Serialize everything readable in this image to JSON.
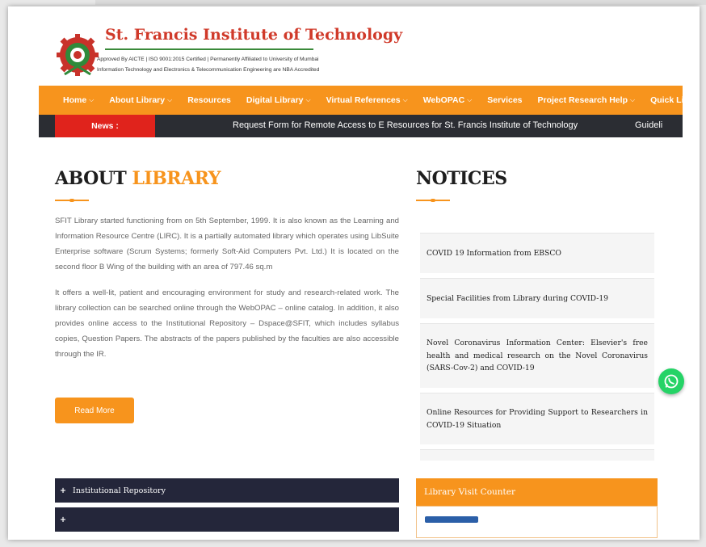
{
  "header": {
    "institute_name": "St. Francis Institute of Technology",
    "subtitle_line1": "Approved By AICTE | ISO 9001:2015 Certified | Permanently Affiliated to University of Mumbai",
    "subtitle_line2": "Information Technology and Electronics & Telecommunication Engineering are NBA Accredited"
  },
  "nav": {
    "items": [
      {
        "label": "Home",
        "dropdown": true
      },
      {
        "label": "About Library",
        "dropdown": true
      },
      {
        "label": "Resources",
        "dropdown": false
      },
      {
        "label": "Digital Library",
        "dropdown": true
      },
      {
        "label": "Virtual References",
        "dropdown": true
      },
      {
        "label": "WebOPAC",
        "dropdown": true
      },
      {
        "label": "Services",
        "dropdown": false
      },
      {
        "label": "Project Research Help",
        "dropdown": true
      },
      {
        "label": "Quick Links",
        "dropdown": true
      }
    ]
  },
  "news": {
    "label": "News :",
    "ticker": "Request Form for Remote Access to E Resources for St. Francis Institute of Technology",
    "ticker_next": "Guideli"
  },
  "about": {
    "title_main": "ABOUT ",
    "title_accent": "LIBRARY",
    "para1": "SFIT Library started functioning from on 5th September, 1999. It is also known as the Learning and Information Resource Centre (LIRC). It is a partially automated library which operates using LibSuite Enterprise software (Scrum Systems; formerly Soft-Aid Computers Pvt. Ltd.) It is located on the second floor B Wing of the building with an area of 797.46 sq.m",
    "para2": "It offers a well-lit, patient and encouraging environment for study and research-related work. The library collection can be searched online through the WebOPAC – online catalog. In addition, it also provides online access to the Institutional Repository – Dspace@SFIT, which includes syllabus copies, Question Papers. The abstracts of the papers published by the faculties are also accessible through the IR.",
    "read_more": "Read More"
  },
  "notices": {
    "title": "NOTICES",
    "items": [
      "COVID 19 Information from EBSCO",
      "Special Facilities from Library during COVID-19",
      "Novel Coronavirus Information Center: Elsevier's free health and medical research on the Novel Coronavirus (SARS-Cov-2) and COVID-19",
      "Online Resources for Providing Support to Researchers in COVID-19 Situation"
    ]
  },
  "accordion": {
    "items": [
      "Institutional Repository"
    ]
  },
  "counter": {
    "title": "Library Visit Counter"
  },
  "colors": {
    "accent": "#f7941d",
    "news_red": "#e0231c",
    "dark": "#2b2d33",
    "whatsapp": "#25d366"
  }
}
